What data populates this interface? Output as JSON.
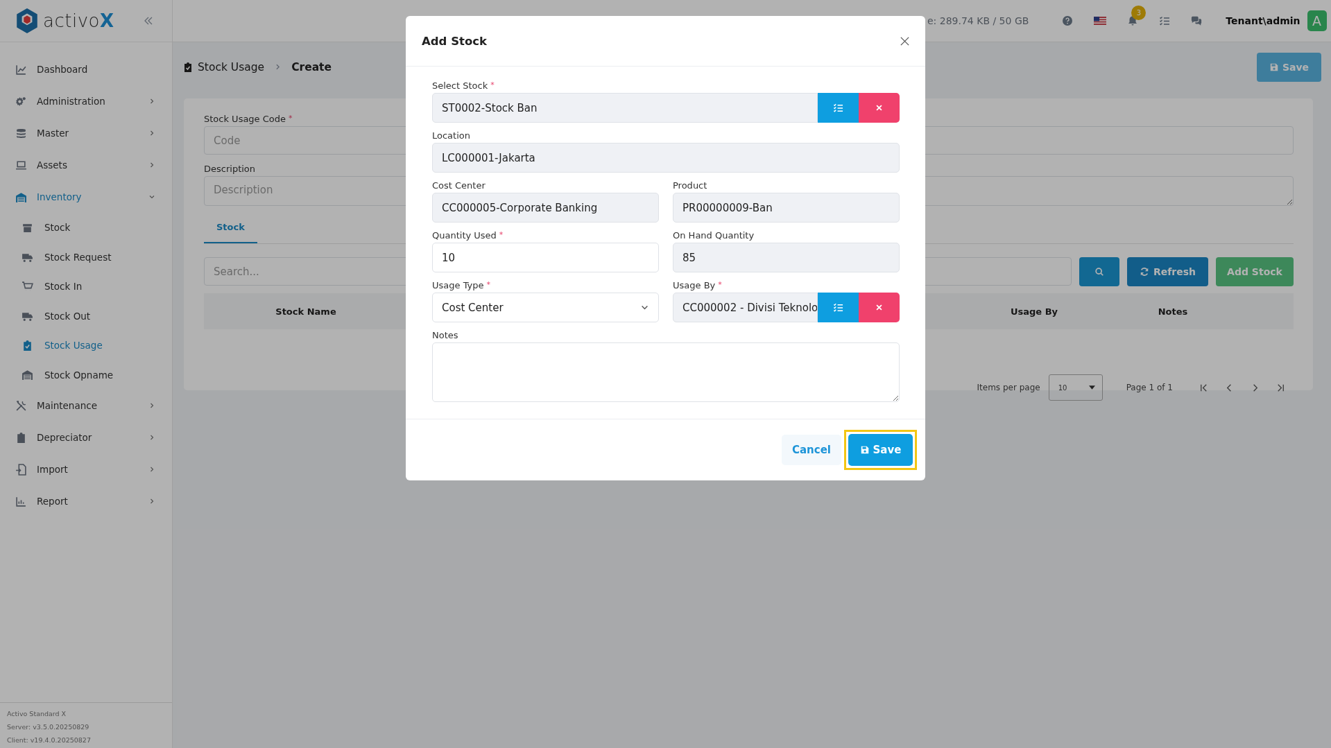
{
  "app": {
    "logo": "activo",
    "logo_accent": "X"
  },
  "header": {
    "storage": "e: 289.74 KB / 50 GB",
    "notification_count": "3",
    "user": "Tenant\\admin",
    "avatar": "A"
  },
  "sidebar": {
    "items": [
      {
        "label": "Dashboard",
        "selected": false
      },
      {
        "label": "Administration",
        "selected": false,
        "expanded": false
      },
      {
        "label": "Master",
        "selected": false,
        "expanded": false
      },
      {
        "label": "Assets",
        "selected": false,
        "expanded": false
      },
      {
        "label": "Inventory",
        "selected": true,
        "expanded": true,
        "children": [
          {
            "label": "Stock",
            "selected": false
          },
          {
            "label": "Stock Request",
            "selected": false
          },
          {
            "label": "Stock In",
            "selected": false
          },
          {
            "label": "Stock Out",
            "selected": false
          },
          {
            "label": "Stock Usage",
            "selected": true
          },
          {
            "label": "Stock Opname",
            "selected": false
          }
        ]
      },
      {
        "label": "Maintenance",
        "selected": false,
        "expanded": false
      },
      {
        "label": "Depreciator",
        "selected": false,
        "expanded": false
      },
      {
        "label": "Import",
        "selected": false,
        "expanded": false
      },
      {
        "label": "Report",
        "selected": false,
        "expanded": false
      }
    ],
    "footer": [
      "Activo Standard X",
      "Server: v3.5.0.20250829",
      "Client: v19.4.0.20250827"
    ]
  },
  "breadcrumb": [
    "Stock Usage",
    "Create"
  ],
  "page_save": "Save",
  "form": {
    "fields": [
      {
        "label": "Stock Usage Code",
        "required_mark": "*",
        "placeholder": "Code",
        "kind": "input"
      },
      {
        "label": "Description",
        "placeholder": "Description",
        "kind": "textarea"
      }
    ]
  },
  "tabs": [
    {
      "label": "Stock",
      "selected": true
    }
  ],
  "search": {
    "placeholder": "Search..."
  },
  "toolbar": {
    "refresh": "Refresh",
    "add": "Add Stock"
  },
  "table": {
    "columns": [
      "Stock Name",
      "Usage By",
      "Notes"
    ]
  },
  "pagination": {
    "items_per_page_label": "Items per page",
    "items_per_page": "10",
    "page": "Page 1 of 1"
  },
  "dialog": {
    "title": "Add Stock",
    "rows": [
      [
        {
          "label": "Select Stock",
          "required_mark": "*",
          "kind": "lookup",
          "value": "ST0002-Stock Ban"
        }
      ],
      [
        {
          "label": "Location",
          "kind": "readonly",
          "value": "LC000001-Jakarta"
        }
      ],
      [
        {
          "label": "Cost Center",
          "kind": "readonly",
          "value": "CC000005-Corporate Banking"
        },
        {
          "label": "Product",
          "kind": "readonly",
          "value": "PR00000009-Ban"
        }
      ],
      [
        {
          "label": "Quantity Used",
          "required_mark": "*",
          "kind": "input",
          "value": "10"
        },
        {
          "label": "On Hand Quantity",
          "kind": "readonly",
          "value": "85"
        }
      ],
      [
        {
          "label": "Usage Type",
          "required_mark": "*",
          "kind": "select",
          "value": "Cost Center"
        },
        {
          "label": "Usage By",
          "required_mark": "*",
          "kind": "lookup",
          "value": "CC000002 - Divisi Teknolo"
        }
      ],
      [
        {
          "label": "Notes",
          "kind": "textarea"
        }
      ]
    ],
    "cancel": "Cancel",
    "save": "Save",
    "save_highlighted": true
  }
}
